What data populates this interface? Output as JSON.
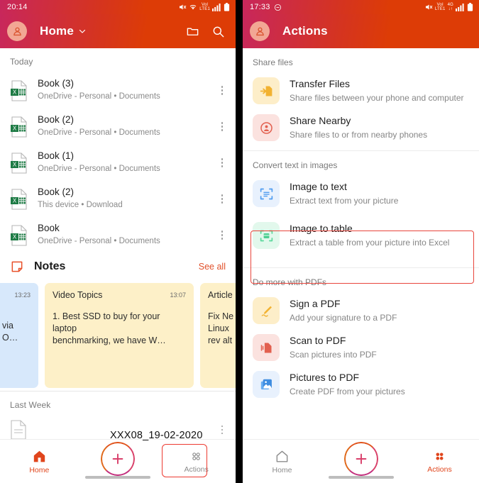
{
  "left": {
    "status": {
      "time": "20:14",
      "icons": [
        "mute-icon",
        "wifi-icon",
        "volte-lte1-icon",
        "signal-bars-icon",
        "battery-icon"
      ]
    },
    "header": {
      "title": "Home",
      "avatar": "account-avatar",
      "chevron": "chevron-down-icon",
      "folder": "folder-icon",
      "search": "search-icon"
    },
    "sections": [
      {
        "label": "Today"
      },
      {
        "label": "Last Week"
      }
    ],
    "files": [
      {
        "name": "Book (3)",
        "sub": "OneDrive - Personal • Documents",
        "icon": "excel-file-icon"
      },
      {
        "name": "Book (2)",
        "sub": "OneDrive - Personal • Documents",
        "icon": "excel-file-icon"
      },
      {
        "name": "Book (1)",
        "sub": "OneDrive - Personal • Documents",
        "icon": "excel-file-icon"
      },
      {
        "name": "Book (2)",
        "sub": "This device • Download",
        "icon": "excel-file-icon"
      },
      {
        "name": "Book",
        "sub": "OneDrive - Personal • Documents",
        "icon": "excel-file-icon"
      }
    ],
    "notes": {
      "title": "Notes",
      "see_all": "See all",
      "icon": "sticky-note-icon",
      "cards": [
        {
          "title": "",
          "time": "13:23",
          "body": "via O…",
          "color": "#d7e8fb"
        },
        {
          "title": "Video Topics",
          "time": "13:07",
          "body": "1. Best SSD to buy for your laptop\nbenchmarking, we have W…",
          "color": "#fdf0c8"
        },
        {
          "title": "Article",
          "time": "",
          "body": "Fix Ne\nLinux\nrev alt",
          "color": "#fdf0c8"
        }
      ]
    },
    "last_week_file": {
      "name": "XXX08_19-02-2020",
      "icon": "generic-file-icon"
    },
    "nav": {
      "home": {
        "label": "Home",
        "icon": "home-icon",
        "active": true
      },
      "fab": {
        "icon": "plus-icon"
      },
      "actions": {
        "label": "Actions",
        "icon": "grid-dots-icon",
        "active": false
      }
    }
  },
  "right": {
    "status": {
      "time": "17:33",
      "dnd": "do-not-disturb-icon",
      "icons": [
        "mute-icon",
        "volte-lte1-icon",
        "4g-icon",
        "signal-bars-icon",
        "battery-icon"
      ]
    },
    "header": {
      "title": "Actions",
      "avatar": "account-avatar"
    },
    "groups": [
      {
        "label": "Share files",
        "items": [
          {
            "title": "Transfer Files",
            "sub": "Share files between your phone and computer",
            "icon": "transfer-files-icon",
            "tile_bg": "#fdeec9",
            "icon_color": "#f2b231"
          },
          {
            "title": "Share Nearby",
            "sub": "Share files to or from nearby phones",
            "icon": "share-nearby-icon",
            "tile_bg": "#fbe2df",
            "icon_color": "#e2604f"
          }
        ]
      },
      {
        "label": "Convert text in images",
        "items": [
          {
            "title": "Image to text",
            "sub": "Extract text from your picture",
            "icon": "image-to-text-icon",
            "tile_bg": "#e8f1fd",
            "icon_color": "#4f9cf0"
          },
          {
            "title": "Image to table",
            "sub": "Extract a table from your picture into Excel",
            "icon": "image-to-table-icon",
            "tile_bg": "#e2f8ec",
            "icon_color": "#5ad79b",
            "highlighted": true
          }
        ]
      },
      {
        "label": "Do more with PDFs",
        "items": [
          {
            "title": "Sign a PDF",
            "sub": "Add your signature to a PDF",
            "icon": "sign-pdf-icon",
            "tile_bg": "#fdeec9",
            "icon_color": "#f2b231"
          },
          {
            "title": "Scan to PDF",
            "sub": "Scan pictures into PDF",
            "icon": "scan-to-pdf-icon",
            "tile_bg": "#fbe2df",
            "icon_color": "#e2604f"
          },
          {
            "title": "Pictures to PDF",
            "sub": "Create PDF from your pictures",
            "icon": "pictures-to-pdf-icon",
            "tile_bg": "#e8f1fd",
            "icon_color": "#4f9cf0"
          }
        ]
      }
    ],
    "nav": {
      "home": {
        "label": "Home",
        "icon": "home-icon",
        "active": false
      },
      "fab": {
        "icon": "plus-icon"
      },
      "actions": {
        "label": "Actions",
        "icon": "grid-dots-icon",
        "active": true
      }
    }
  },
  "annotations": {
    "color": "#ed3b31"
  }
}
